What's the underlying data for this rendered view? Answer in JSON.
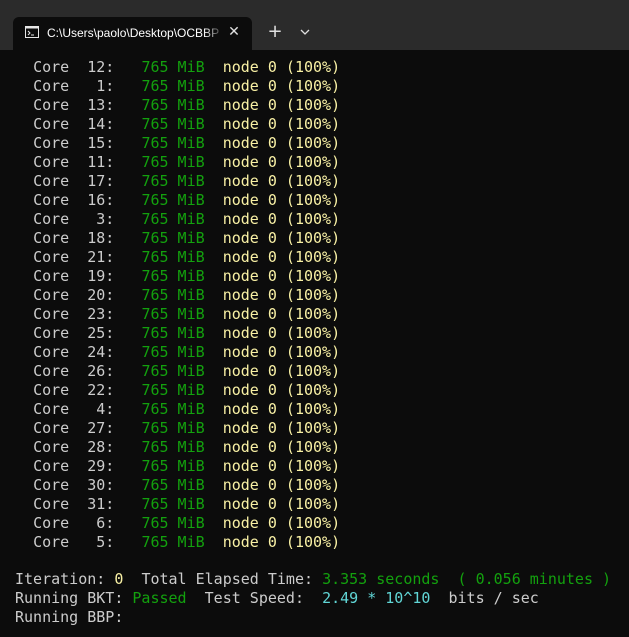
{
  "tab": {
    "icon": "terminal-icon",
    "title": "C:\\Users\\paolo\\Desktop\\OCBBP",
    "close_label": "✕"
  },
  "toolbar": {
    "new_tab_label": "+",
    "dropdown_icon": "chevron-down-icon"
  },
  "colors": {
    "background": "#0c0c0c",
    "tabbar": "#2b2b2b",
    "default_text": "#cccccc",
    "green": "#13a10e",
    "yellow": "#f9f1a5",
    "cyan": "#61d6d6"
  },
  "cores": [
    {
      "label": "Core",
      "num": "12:",
      "mem": "765 MiB",
      "node": "node 0 (100%)"
    },
    {
      "label": "Core",
      "num": " 1:",
      "mem": "765 MiB",
      "node": "node 0 (100%)"
    },
    {
      "label": "Core",
      "num": "13:",
      "mem": "765 MiB",
      "node": "node 0 (100%)"
    },
    {
      "label": "Core",
      "num": "14:",
      "mem": "765 MiB",
      "node": "node 0 (100%)"
    },
    {
      "label": "Core",
      "num": "15:",
      "mem": "765 MiB",
      "node": "node 0 (100%)"
    },
    {
      "label": "Core",
      "num": "11:",
      "mem": "765 MiB",
      "node": "node 0 (100%)"
    },
    {
      "label": "Core",
      "num": "17:",
      "mem": "765 MiB",
      "node": "node 0 (100%)"
    },
    {
      "label": "Core",
      "num": "16:",
      "mem": "765 MiB",
      "node": "node 0 (100%)"
    },
    {
      "label": "Core",
      "num": " 3:",
      "mem": "765 MiB",
      "node": "node 0 (100%)"
    },
    {
      "label": "Core",
      "num": "18:",
      "mem": "765 MiB",
      "node": "node 0 (100%)"
    },
    {
      "label": "Core",
      "num": "21:",
      "mem": "765 MiB",
      "node": "node 0 (100%)"
    },
    {
      "label": "Core",
      "num": "19:",
      "mem": "765 MiB",
      "node": "node 0 (100%)"
    },
    {
      "label": "Core",
      "num": "20:",
      "mem": "765 MiB",
      "node": "node 0 (100%)"
    },
    {
      "label": "Core",
      "num": "23:",
      "mem": "765 MiB",
      "node": "node 0 (100%)"
    },
    {
      "label": "Core",
      "num": "25:",
      "mem": "765 MiB",
      "node": "node 0 (100%)"
    },
    {
      "label": "Core",
      "num": "24:",
      "mem": "765 MiB",
      "node": "node 0 (100%)"
    },
    {
      "label": "Core",
      "num": "26:",
      "mem": "765 MiB",
      "node": "node 0 (100%)"
    },
    {
      "label": "Core",
      "num": "22:",
      "mem": "765 MiB",
      "node": "node 0 (100%)"
    },
    {
      "label": "Core",
      "num": " 4:",
      "mem": "765 MiB",
      "node": "node 0 (100%)"
    },
    {
      "label": "Core",
      "num": "27:",
      "mem": "765 MiB",
      "node": "node 0 (100%)"
    },
    {
      "label": "Core",
      "num": "28:",
      "mem": "765 MiB",
      "node": "node 0 (100%)"
    },
    {
      "label": "Core",
      "num": "29:",
      "mem": "765 MiB",
      "node": "node 0 (100%)"
    },
    {
      "label": "Core",
      "num": "30:",
      "mem": "765 MiB",
      "node": "node 0 (100%)"
    },
    {
      "label": "Core",
      "num": "31:",
      "mem": "765 MiB",
      "node": "node 0 (100%)"
    },
    {
      "label": "Core",
      "num": " 6:",
      "mem": "765 MiB",
      "node": "node 0 (100%)"
    },
    {
      "label": "Core",
      "num": " 5:",
      "mem": "765 MiB",
      "node": "node 0 (100%)"
    }
  ],
  "status": {
    "iteration_label": "Iteration:",
    "iteration_value": "0",
    "elapsed_label": "Total Elapsed Time:",
    "elapsed_seconds": "3.353 seconds",
    "elapsed_minutes": "( 0.056 minutes )",
    "bkt_label": "Running BKT:",
    "bkt_status": "Passed",
    "speed_label": "Test Speed:",
    "speed_value": "2.49 * 10^10",
    "speed_unit": "bits / sec",
    "bbp_label": "Running BBP:"
  }
}
